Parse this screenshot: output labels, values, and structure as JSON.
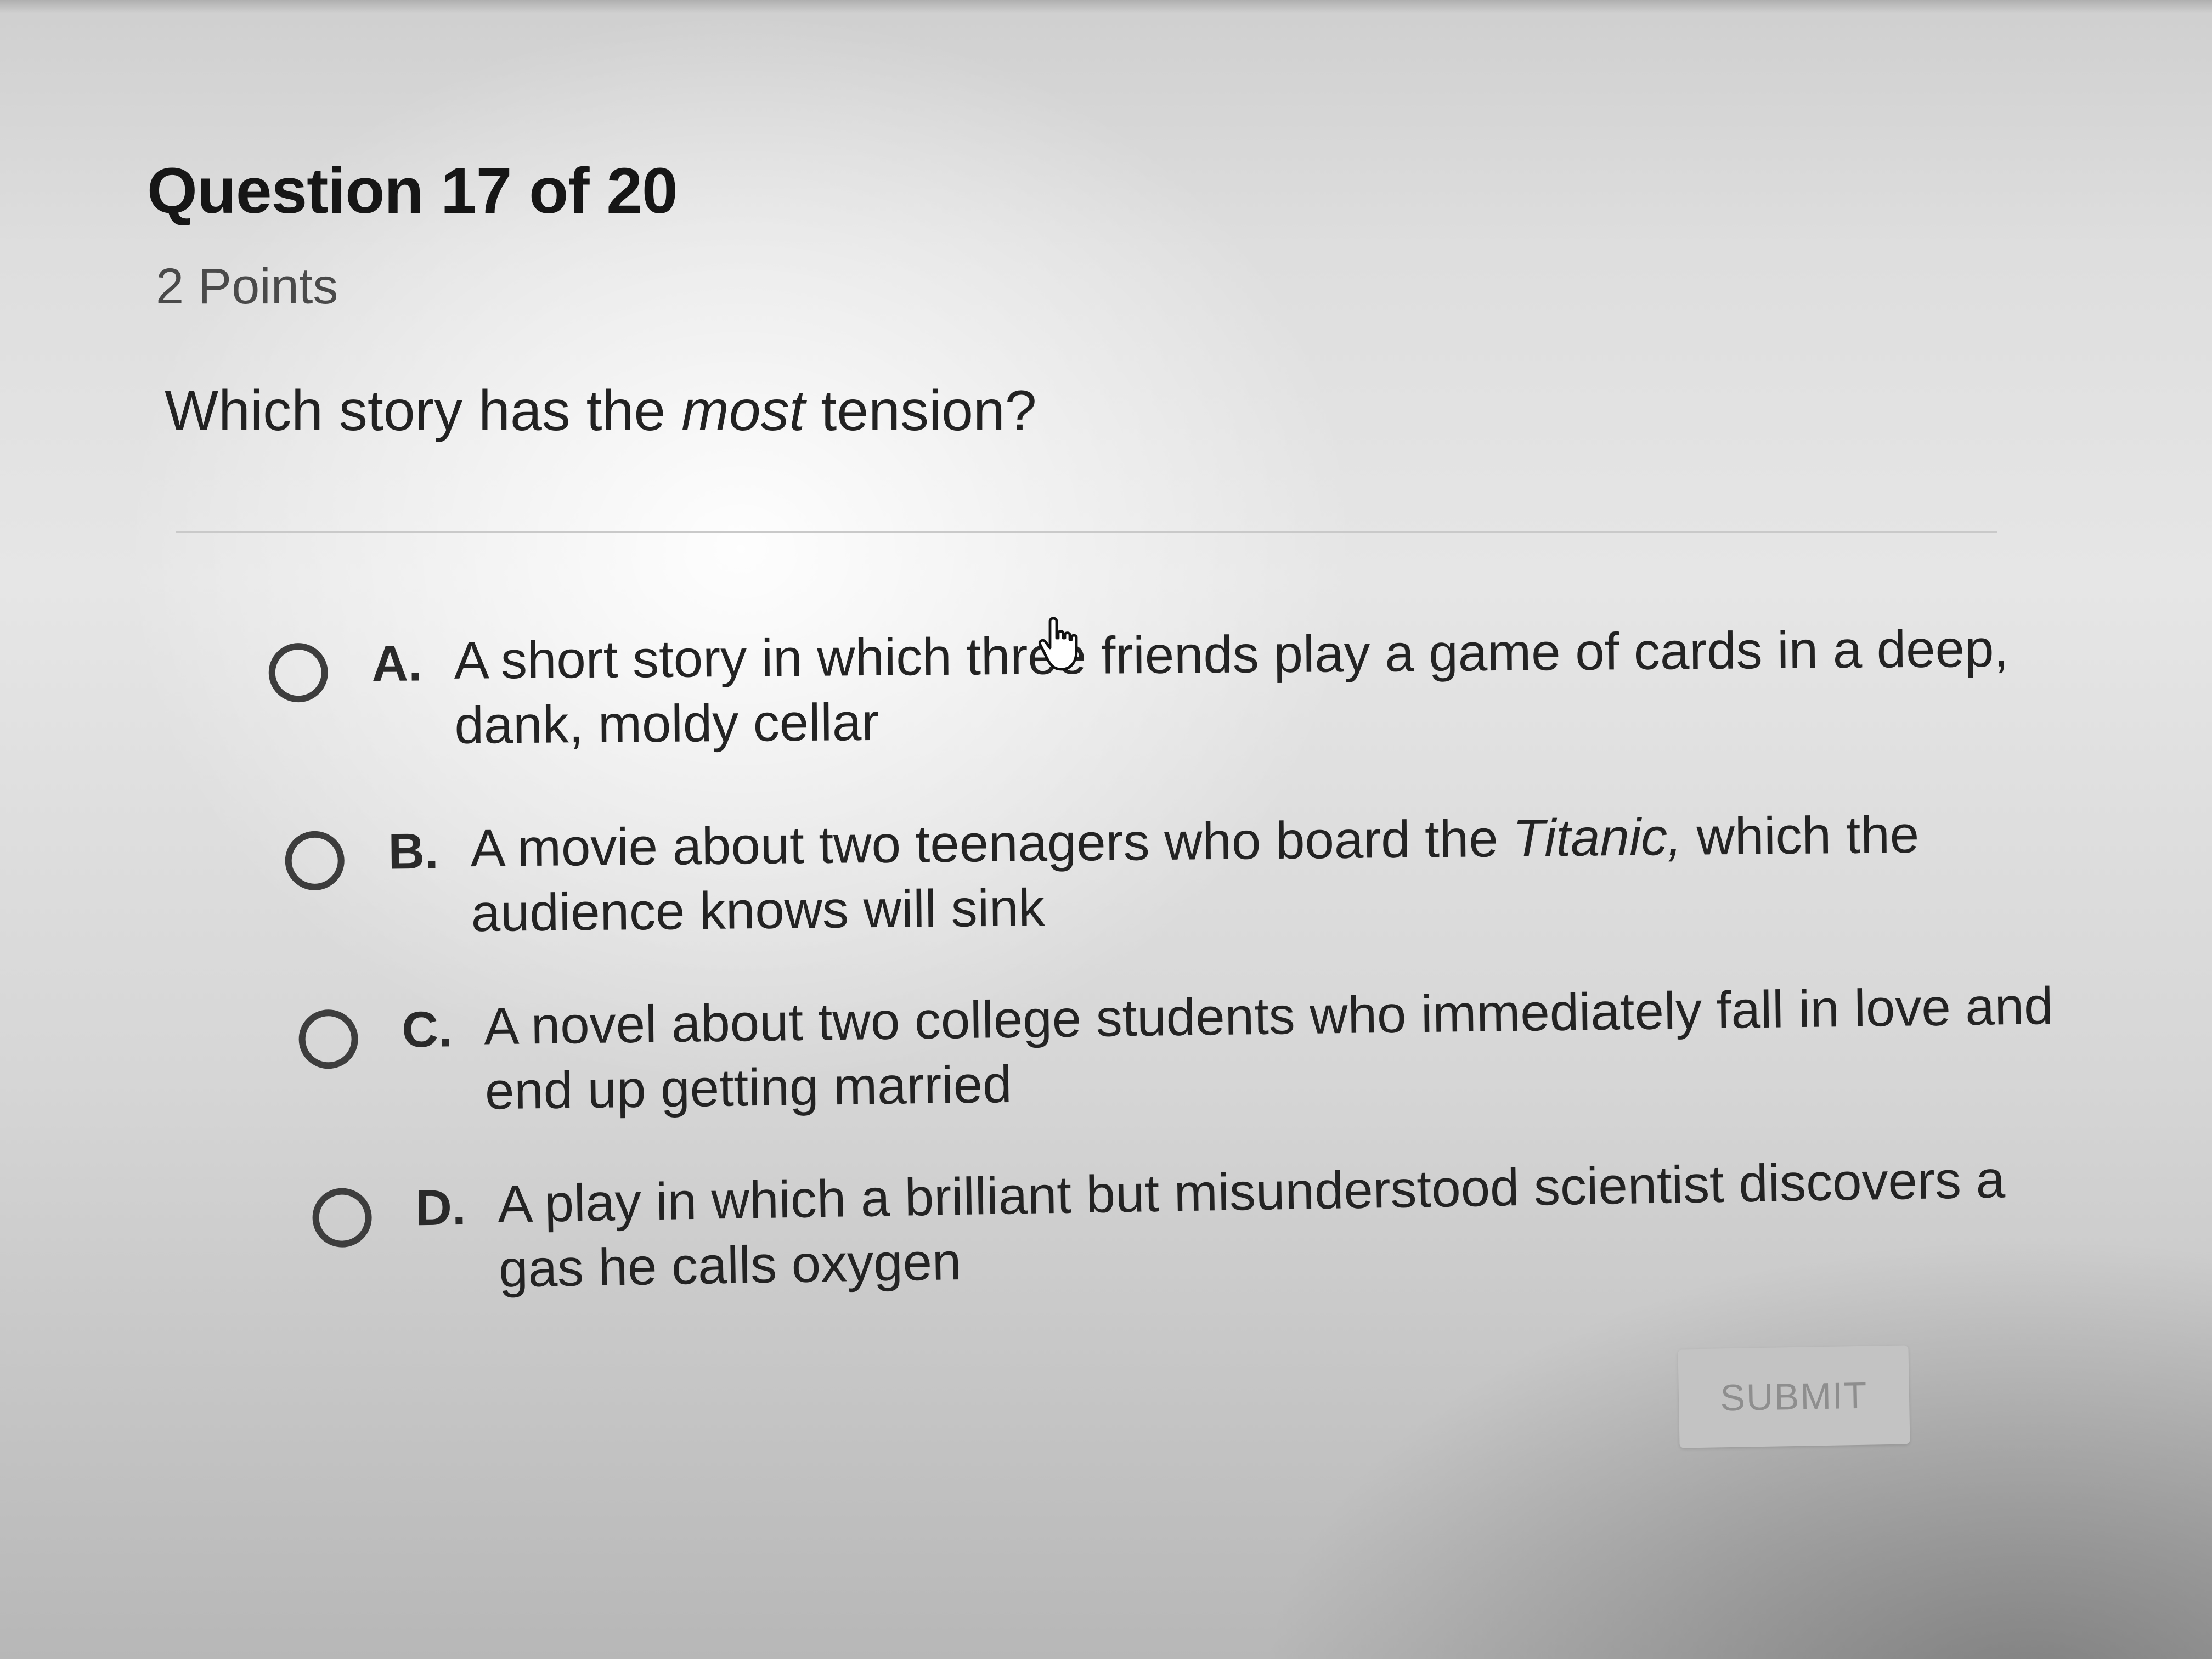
{
  "question": {
    "title": "Question 17 of 20",
    "points": "2 Points",
    "prompt_before": "Which story has the ",
    "prompt_emphasis": "most",
    "prompt_after": " tension?"
  },
  "choices": [
    {
      "letter": "A.",
      "text_before": "A short story in which three friends play a game of cards in a deep, dank, moldy cellar",
      "text_italic": "",
      "text_after": ""
    },
    {
      "letter": "B.",
      "text_before": "A movie about two teenagers who board the ",
      "text_italic": "Titanic,",
      "text_after": " which the audience knows will sink"
    },
    {
      "letter": "C.",
      "text_before": "A novel about two college students who immediately fall in love and end up getting married",
      "text_italic": "",
      "text_after": ""
    },
    {
      "letter": "D.",
      "text_before": "A play in which a brilliant but misunderstood scientist discovers a gas he calls oxygen",
      "text_italic": "",
      "text_after": ""
    }
  ],
  "submit": {
    "label": "SUBMIT"
  },
  "cursor": {
    "icon": "hand-pointer-icon"
  }
}
